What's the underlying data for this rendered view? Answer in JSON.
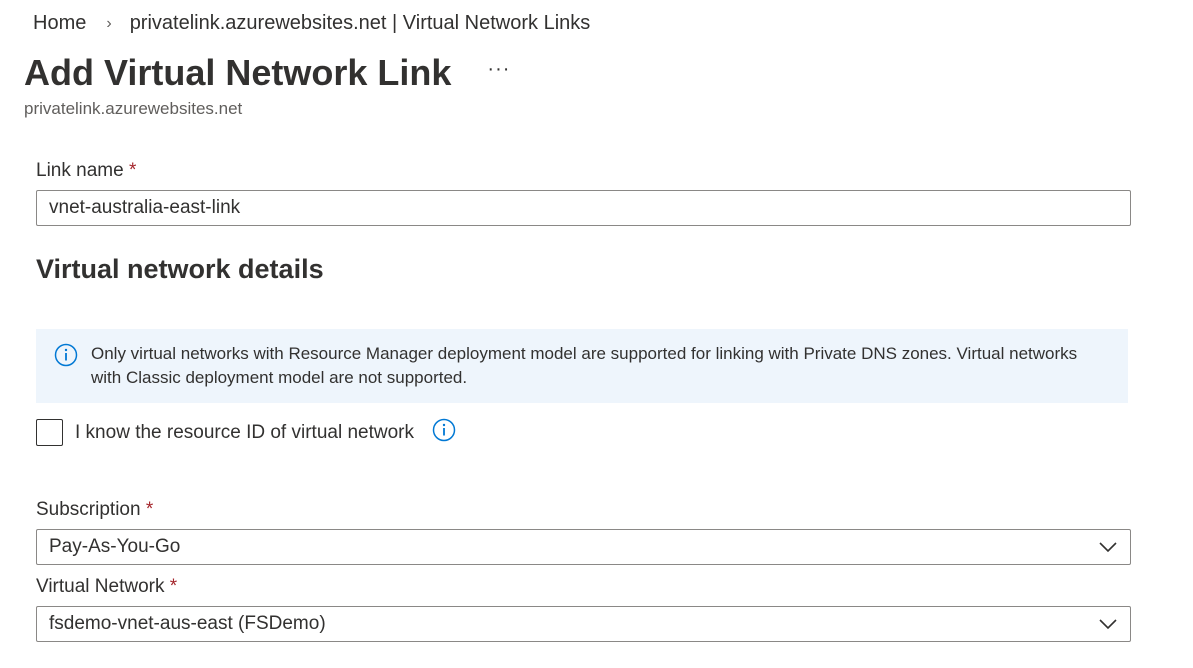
{
  "breadcrumb": {
    "home": "Home",
    "separator": "›",
    "current": "privatelink.azurewebsites.net | Virtual Network Links"
  },
  "header": {
    "title": "Add Virtual Network Link",
    "more": "···",
    "subtitle": "privatelink.azurewebsites.net"
  },
  "form": {
    "link_name": {
      "label": "Link name",
      "required_marker": "*",
      "value": "vnet-australia-east-link"
    },
    "section_title": "Virtual network details",
    "info_message": "Only virtual networks with Resource Manager deployment model are supported for linking with Private DNS zones. Virtual networks with Classic deployment model are not supported.",
    "resource_id_checkbox": {
      "label": "I know the resource ID of virtual network",
      "checked": false
    },
    "subscription": {
      "label": "Subscription",
      "required_marker": "*",
      "value": "Pay-As-You-Go"
    },
    "virtual_network": {
      "label": "Virtual Network",
      "required_marker": "*",
      "value": "fsdemo-vnet-aus-east (FSDemo)"
    }
  },
  "colors": {
    "accent": "#0078d4",
    "required": "#a4262c",
    "info_background": "#eef5fc",
    "text": "#323130"
  },
  "icons": {
    "info": "info-icon",
    "dropdown": "chevron-down-icon"
  }
}
